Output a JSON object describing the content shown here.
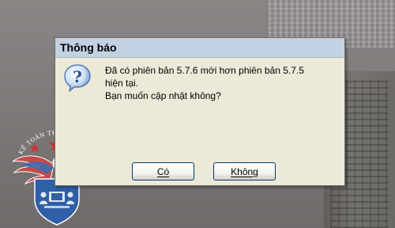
{
  "dialog": {
    "title": "Thông báo",
    "icon": "question-icon",
    "message_lines": [
      "Đã có phiên bản 5.7.6 mới hơn phiên bản 5.7.5",
      "hiện tại.",
      "Bạn muốn cập nhật không?"
    ],
    "buttons": {
      "yes_label": "Có",
      "no_label": "Không"
    }
  },
  "logo": {
    "arc_text": "KẾ TOÁN THIÊN ƯNG",
    "icon": "eagle-shield-logo"
  },
  "colors": {
    "title_bar": "#c2d2e3",
    "dialog_bg": "#ece9d8",
    "button_border": "#003c74",
    "logo_red": "#d0312d",
    "logo_blue": "#2f5fa6"
  }
}
